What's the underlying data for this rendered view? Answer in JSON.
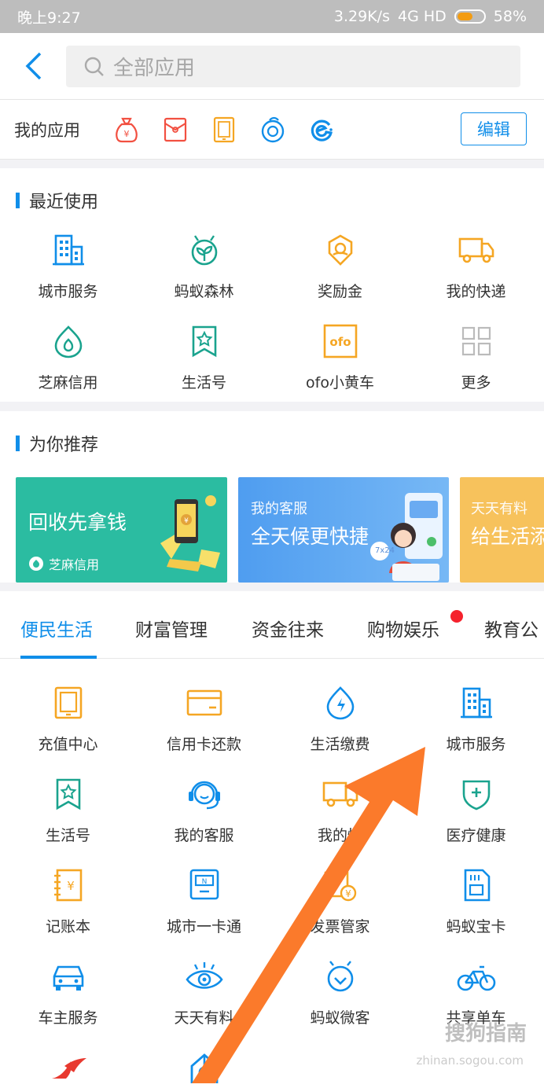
{
  "status_bar": {
    "time": "晚上9:27",
    "speed": "3.29K/s",
    "network": "4G HD",
    "battery": "58%",
    "battery_level": 0.58
  },
  "search": {
    "placeholder": "全部应用"
  },
  "my_apps": {
    "title": "我的应用",
    "edit_label": "编辑",
    "icons": [
      "money-bag-icon",
      "red-envelope-icon",
      "phone-recharge-icon",
      "ant-circle-icon",
      "eleme-icon"
    ]
  },
  "recent": {
    "title": "最近使用",
    "items": [
      {
        "label": "城市服务",
        "icon": "building-icon"
      },
      {
        "label": "蚂蚁森林",
        "icon": "sprout-icon"
      },
      {
        "label": "奖励金",
        "icon": "reward-icon"
      },
      {
        "label": "我的快递",
        "icon": "truck-icon"
      },
      {
        "label": "芝麻信用",
        "icon": "sesame-icon"
      },
      {
        "label": "生活号",
        "icon": "bookmark-star-icon"
      },
      {
        "label": "ofo小黄车",
        "icon": "ofo-icon"
      },
      {
        "label": "更多",
        "icon": "more-grid-icon"
      }
    ]
  },
  "recommend": {
    "title": "为你推荐",
    "banners": [
      {
        "title": "回收先拿钱",
        "subtitle": "芝麻信用"
      },
      {
        "kicker": "我的客服",
        "title": "全天候更快捷",
        "badge": "7x24"
      },
      {
        "kicker": "天天有料",
        "title": "给生活添"
      }
    ]
  },
  "tabs": {
    "items": [
      "便民生活",
      "财富管理",
      "资金往来",
      "购物娱乐",
      "教育公"
    ],
    "active": "便民生活"
  },
  "services": {
    "items": [
      {
        "label": "充值中心",
        "icon": "phone-recharge-icon"
      },
      {
        "label": "信用卡还款",
        "icon": "credit-card-icon"
      },
      {
        "label": "生活缴费",
        "icon": "utility-bolt-icon"
      },
      {
        "label": "城市服务",
        "icon": "building-icon"
      },
      {
        "label": "生活号",
        "icon": "bookmark-star-icon"
      },
      {
        "label": "我的客服",
        "icon": "headset-icon"
      },
      {
        "label": "我的快",
        "icon": "truck-icon"
      },
      {
        "label": "医疗健康",
        "icon": "medical-shield-icon"
      },
      {
        "label": "记账本",
        "icon": "ledger-icon"
      },
      {
        "label": "城市一卡通",
        "icon": "transit-card-icon"
      },
      {
        "label": "发票管家",
        "icon": "invoice-icon"
      },
      {
        "label": "蚂蚁宝卡",
        "icon": "sim-card-icon"
      },
      {
        "label": "车主服务",
        "icon": "car-icon"
      },
      {
        "label": "天天有料",
        "icon": "eye-icon"
      },
      {
        "label": "蚂蚁微客",
        "icon": "ant-heart-icon"
      },
      {
        "label": "共享单车",
        "icon": "bicycle-icon"
      },
      {
        "label": "",
        "icon": "airline-icon"
      },
      {
        "label": "",
        "icon": "tower-icon"
      }
    ]
  },
  "overlay": {
    "watermark": "搜狗指南",
    "watermark_url": "zhinan.sogou.com"
  },
  "colors": {
    "accent": "#108ee9",
    "orange": "#f5a623",
    "teal": "#1aa38e",
    "arrow": "#fb7a2b"
  }
}
